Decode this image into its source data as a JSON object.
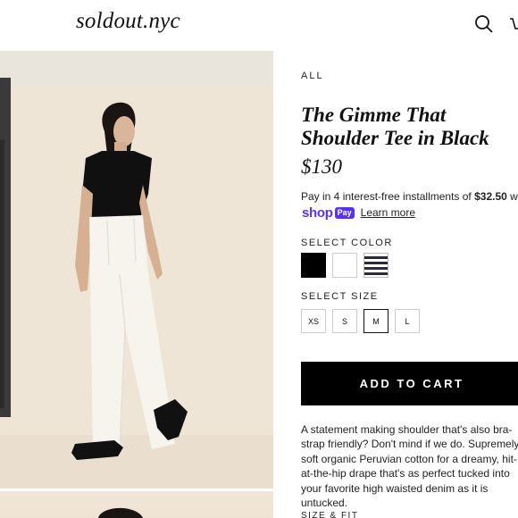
{
  "header": {
    "logo": "soldout.nyc",
    "search_icon": "search-icon",
    "cart_icon": "cart-icon"
  },
  "product": {
    "breadcrumb": "ALL",
    "title": "The Gimme That Shoulder Tee in Black",
    "price": "$130",
    "installments": {
      "prefix": "Pay in 4 interest-free installments of ",
      "amount": "$32.50",
      "suffix": " with",
      "shop_word": "shop",
      "pay_pill": "Pay",
      "learn_more": "Learn more"
    },
    "color": {
      "label": "SELECT COLOR",
      "options": [
        "#000000",
        "#ffffff",
        "stripe"
      ]
    },
    "size": {
      "label": "SELECT SIZE",
      "options": [
        "XS",
        "S",
        "M",
        "L"
      ],
      "selected": "M"
    },
    "add_to_cart": "ADD TO CART",
    "description": "A statement making shoulder that's also bra-strap friendly? Don't mind if we do. Supremely soft organic Peruvian cotton for a dreamy, hit-at-the-hip drape that's as perfect tucked into your favorite high waisted denim as it is untucked.",
    "size_fit_label": "SIZE & FIT"
  },
  "colors": {
    "shop_pay": "#5a31f4",
    "button_bg": "#000000",
    "backdrop": "#efe5d7"
  }
}
